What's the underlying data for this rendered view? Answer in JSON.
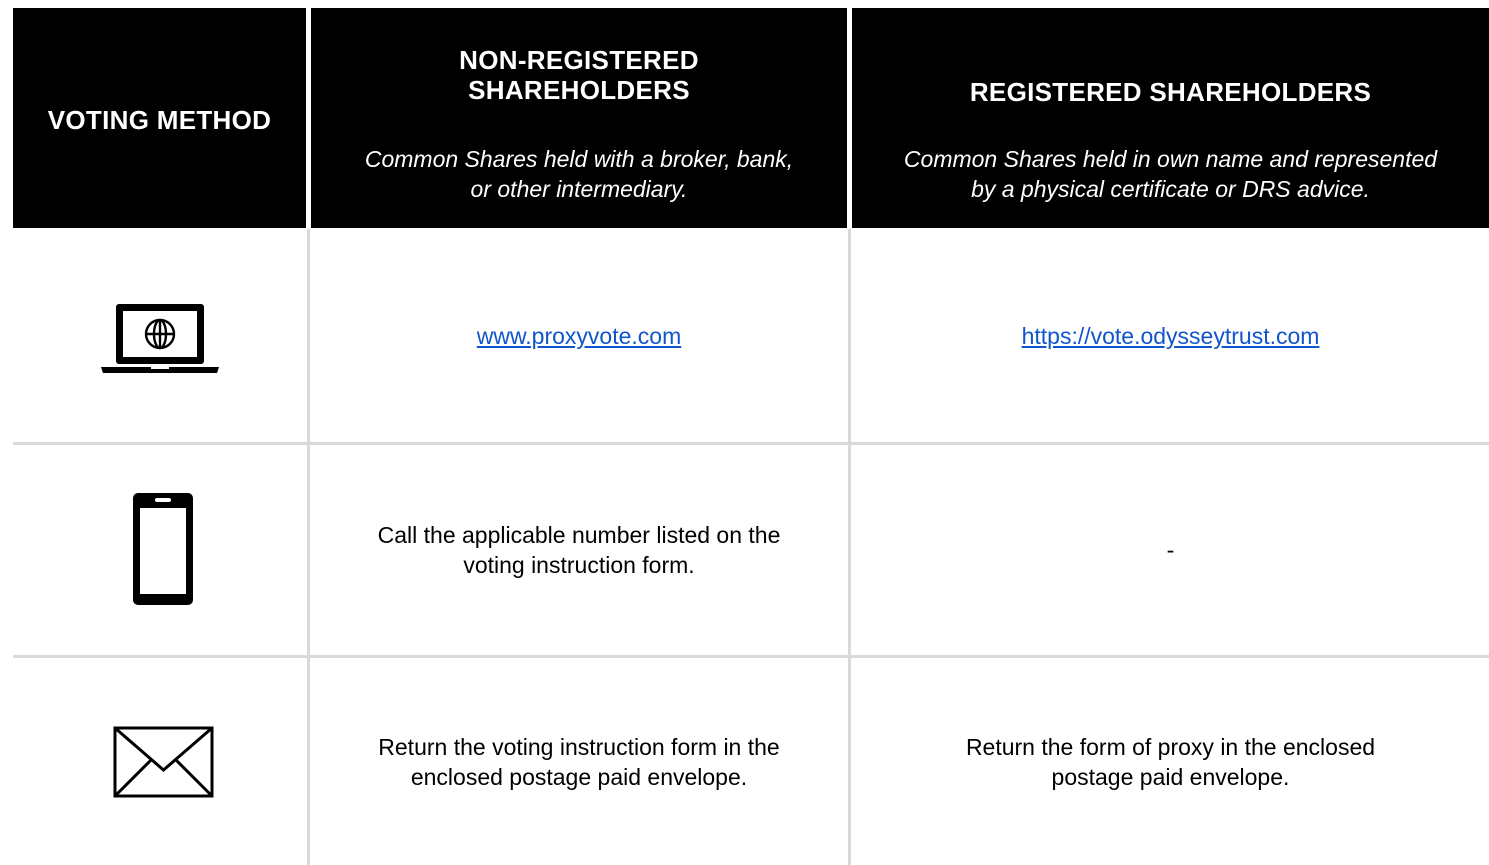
{
  "header": {
    "col1_title": "VOTING METHOD",
    "col2_title_line1": "NON-REGISTERED",
    "col2_title_line2": "SHAREHOLDERS",
    "col2_subtitle_line1": "Common Shares held with a broker, bank,",
    "col2_subtitle_line2": "or other intermediary.",
    "col3_title": "REGISTERED SHAREHOLDERS",
    "col3_subtitle_line1": "Common Shares held in own name and represented",
    "col3_subtitle_line2": "by a physical certificate or DRS advice."
  },
  "rows": [
    {
      "icon": "laptop-globe-icon",
      "non_registered": "www.proxyvote.com",
      "registered": "https://vote.odysseytrust.com"
    },
    {
      "icon": "mobile-phone-icon",
      "non_registered_line1": "Call the applicable number listed on the",
      "non_registered_line2": "voting instruction form.",
      "registered": "-"
    },
    {
      "icon": "envelope-icon",
      "non_registered_line1": "Return the voting instruction form in the",
      "non_registered_line2": "enclosed postage paid envelope.",
      "registered_line1": "Return the form of proxy in the enclosed",
      "registered_line2": "postage paid envelope."
    }
  ],
  "colors": {
    "header_bg": "#000000",
    "header_text": "#ffffff",
    "link": "#1155cc",
    "grid": "#d9d9d9"
  }
}
